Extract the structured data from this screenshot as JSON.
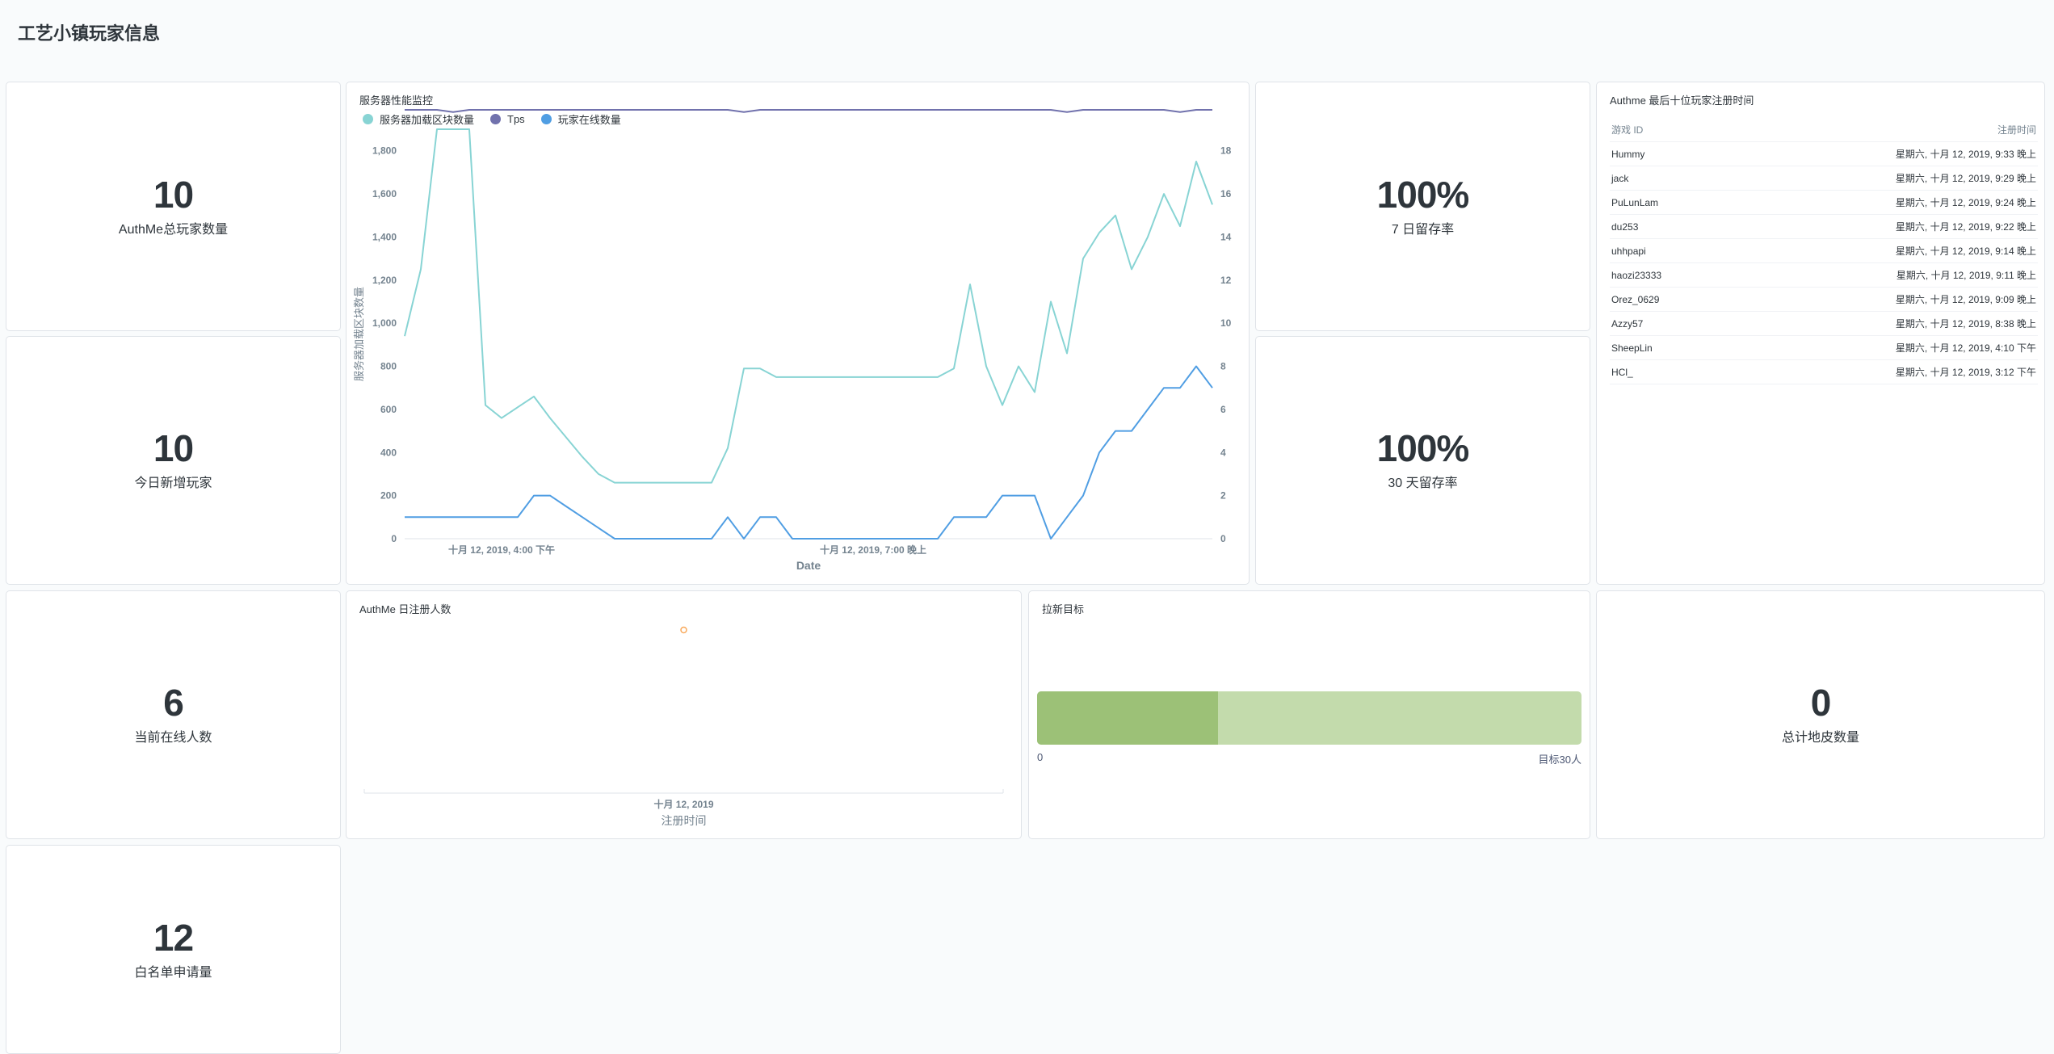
{
  "dashboard": {
    "title": "工艺小镇玩家信息"
  },
  "scalars": {
    "total_players": {
      "value": "10",
      "label": "AuthMe总玩家数量"
    },
    "new_today": {
      "value": "10",
      "label": "今日新增玩家"
    },
    "online_now": {
      "value": "6",
      "label": "当前在线人数"
    },
    "whitelist_requests": {
      "value": "12",
      "label": "白名单申请量"
    },
    "retention_7d": {
      "value": "100%",
      "label": "7 日留存率"
    },
    "retention_30d": {
      "value": "100%",
      "label": "30 天留存率"
    },
    "total_plots": {
      "value": "0",
      "label": "总计地皮数量"
    }
  },
  "perf_card": {
    "title": "服务器性能监控"
  },
  "reg_card": {
    "title": "AuthMe 日注册人数"
  },
  "goal_card": {
    "title": "拉新目标",
    "min_label": "0",
    "goal_label": "目标30人",
    "progress": 0.333,
    "colors": {
      "fill": "#9cc177",
      "track": "#c3dbac"
    }
  },
  "table": {
    "title": "Authme 最后十位玩家注册时间",
    "columns": [
      "游戏 ID",
      "注册时间"
    ],
    "rows": [
      [
        "Hummy",
        "星期六, 十月 12, 2019, 9:33 晚上"
      ],
      [
        "jack",
        "星期六, 十月 12, 2019, 9:29 晚上"
      ],
      [
        "PuLunLam",
        "星期六, 十月 12, 2019, 9:24 晚上"
      ],
      [
        "du253",
        "星期六, 十月 12, 2019, 9:22 晚上"
      ],
      [
        "uhhpapi",
        "星期六, 十月 12, 2019, 9:14 晚上"
      ],
      [
        "haozi23333",
        "星期六, 十月 12, 2019, 9:11 晚上"
      ],
      [
        "Orez_0629",
        "星期六, 十月 12, 2019, 9:09 晚上"
      ],
      [
        "Azzy57",
        "星期六, 十月 12, 2019, 8:38 晚上"
      ],
      [
        "SheepLin",
        "星期六, 十月 12, 2019, 4:10 下午"
      ],
      [
        "HCl_",
        "星期六, 十月 12, 2019, 3:12 下午"
      ]
    ]
  },
  "chart_data": [
    {
      "type": "line",
      "title": "服务器性能监控",
      "xlabel": "Date",
      "ylabel_left": "服务器加载区块数量",
      "x_ticks": [
        "十月 12, 2019, 4:00 下午",
        "十月 12, 2019, 7:00 晚上"
      ],
      "x": [
        0,
        2,
        4,
        6,
        8,
        10,
        12,
        14,
        16,
        18,
        20,
        22,
        24,
        26,
        28,
        30,
        32,
        34,
        36,
        38,
        40,
        42,
        44,
        46,
        48,
        50,
        52,
        54,
        56,
        58,
        60,
        62,
        64,
        66,
        68,
        70,
        72,
        74,
        76,
        78,
        80,
        82,
        84,
        86,
        88,
        90,
        92,
        94,
        96,
        98,
        100
      ],
      "ylim_left": [
        0,
        1900
      ],
      "ylim_right": [
        0,
        19
      ],
      "y_ticks_left": [
        0,
        200,
        400,
        600,
        800,
        1000,
        1200,
        1400,
        1600,
        1800
      ],
      "y_ticks_right": [
        0,
        2,
        4,
        6,
        8,
        10,
        12,
        14,
        16,
        18
      ],
      "legend": {
        "position": "top-left"
      },
      "series": [
        {
          "name": "服务器加载区块数量",
          "axis": "left",
          "color": "#88d4d4",
          "values": [
            940,
            1250,
            1900,
            1900,
            1900,
            620,
            560,
            610,
            660,
            560,
            470,
            380,
            300,
            260,
            260,
            260,
            260,
            260,
            260,
            260,
            420,
            790,
            790,
            750,
            750,
            750,
            750,
            750,
            750,
            750,
            750,
            750,
            750,
            750,
            790,
            1180,
            800,
            620,
            800,
            680,
            1100,
            860,
            1300,
            1420,
            1500,
            1250,
            1400,
            1600,
            1450,
            1750,
            1550
          ]
        },
        {
          "name": "Tps",
          "axis": "right",
          "color": "#7172ad",
          "values": [
            19.9,
            19.9,
            19.9,
            19.8,
            19.9,
            19.9,
            19.9,
            19.9,
            19.9,
            19.9,
            19.9,
            19.9,
            19.9,
            19.9,
            19.9,
            19.9,
            19.9,
            19.9,
            19.9,
            19.9,
            19.9,
            19.8,
            19.9,
            19.9,
            19.9,
            19.9,
            19.9,
            19.9,
            19.9,
            19.9,
            19.9,
            19.9,
            19.9,
            19.9,
            19.9,
            19.9,
            19.9,
            19.9,
            19.9,
            19.9,
            19.9,
            19.8,
            19.9,
            19.9,
            19.9,
            19.9,
            19.9,
            19.9,
            19.8,
            19.9,
            19.9
          ]
        },
        {
          "name": "玩家在线数量",
          "axis": "right",
          "color": "#509ee3",
          "values": [
            1,
            1,
            1,
            1,
            1,
            1,
            1,
            1,
            2,
            2,
            1.5,
            1,
            0.5,
            0,
            0,
            0,
            0,
            0,
            0,
            0,
            1,
            0,
            1,
            1,
            0,
            0,
            0,
            0,
            0,
            0,
            0,
            0,
            0,
            0,
            1,
            1,
            1,
            2,
            2,
            2,
            0,
            1,
            2,
            4,
            5,
            5,
            6,
            7,
            7,
            8,
            7
          ]
        }
      ]
    },
    {
      "type": "scatter",
      "title": "AuthMe 日注册人数",
      "xlabel": "注册时间",
      "x": [
        "十月 12, 2019"
      ],
      "y": [
        10
      ],
      "color": "#f9a95b"
    }
  ]
}
